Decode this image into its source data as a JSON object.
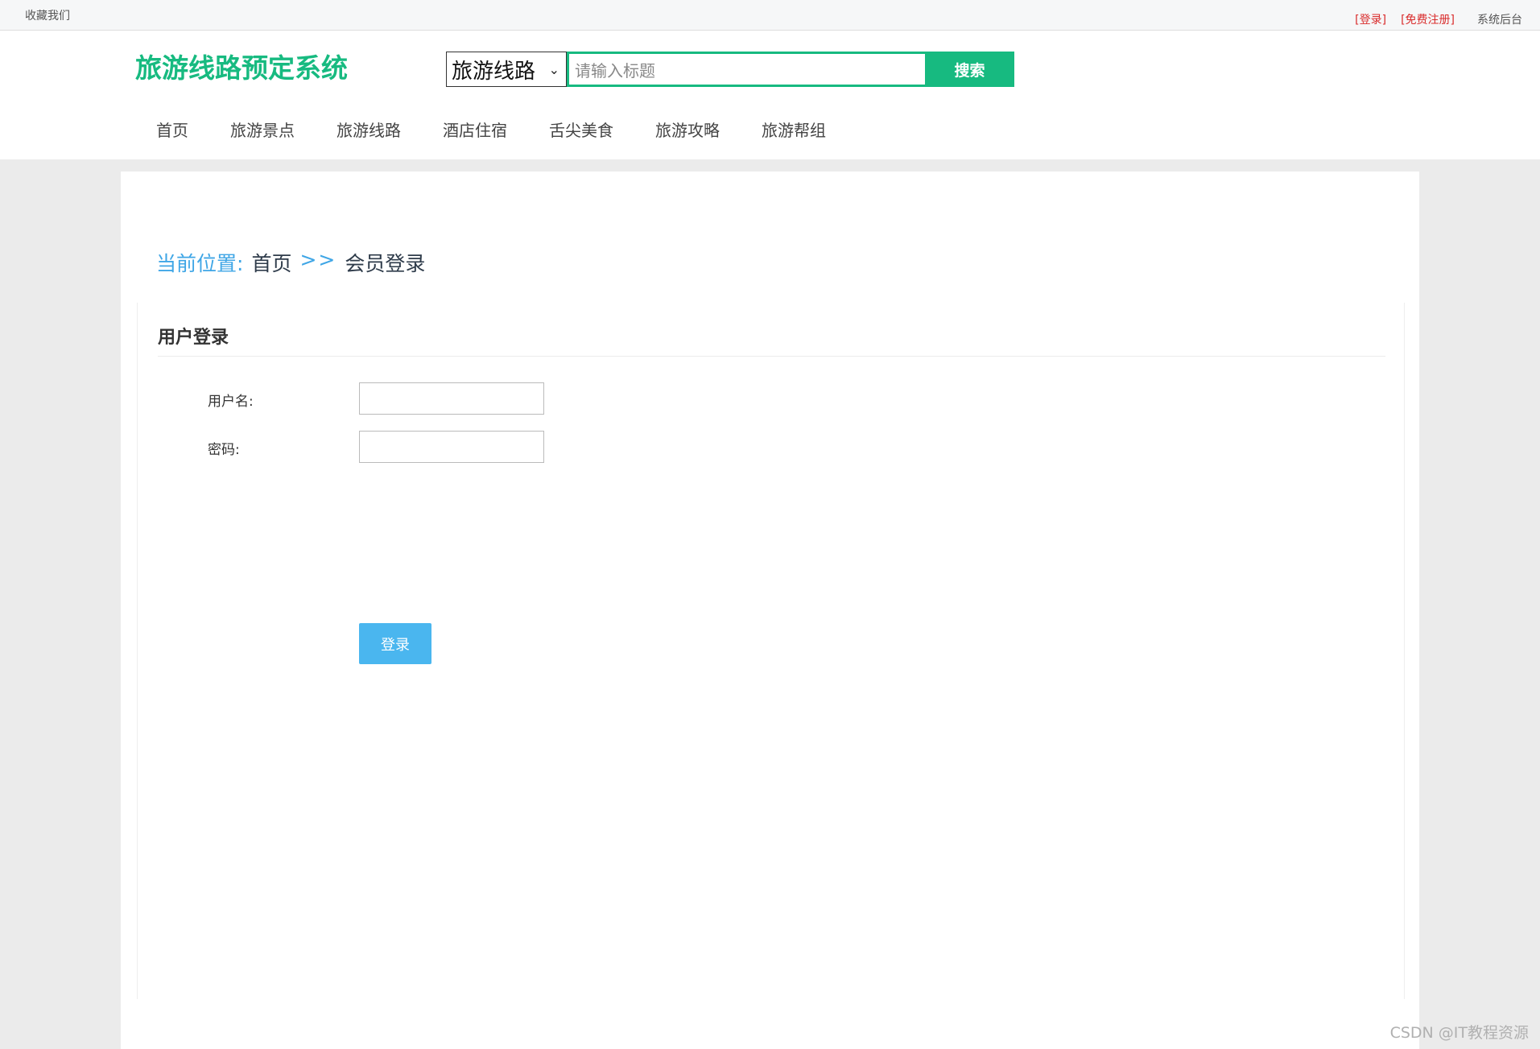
{
  "topbar": {
    "favorite": "收藏我们",
    "login": "[登录]",
    "register": "[免费注册]",
    "admin": "系统后台"
  },
  "header": {
    "logo": "旅游线路预定系统",
    "search": {
      "category": "旅游线路",
      "placeholder": "请输入标题",
      "button": "搜索"
    },
    "nav": [
      "首页",
      "旅游景点",
      "旅游线路",
      "酒店住宿",
      "舌尖美食",
      "旅游攻略",
      "旅游帮组"
    ]
  },
  "breadcrumb": {
    "label": "当前位置:",
    "home": "首页",
    "separator": ">>",
    "current": "会员登录"
  },
  "login": {
    "title": "用户登录",
    "username_label": "用户名:",
    "password_label": "密码:",
    "username_value": "",
    "password_value": "",
    "submit": "登录"
  },
  "watermark": "CSDN @IT教程资源",
  "colors": {
    "brand": "#17ba80",
    "link_red": "#d92c2c",
    "accent_blue": "#3fa6e6",
    "button_blue": "#4ab6ef"
  }
}
